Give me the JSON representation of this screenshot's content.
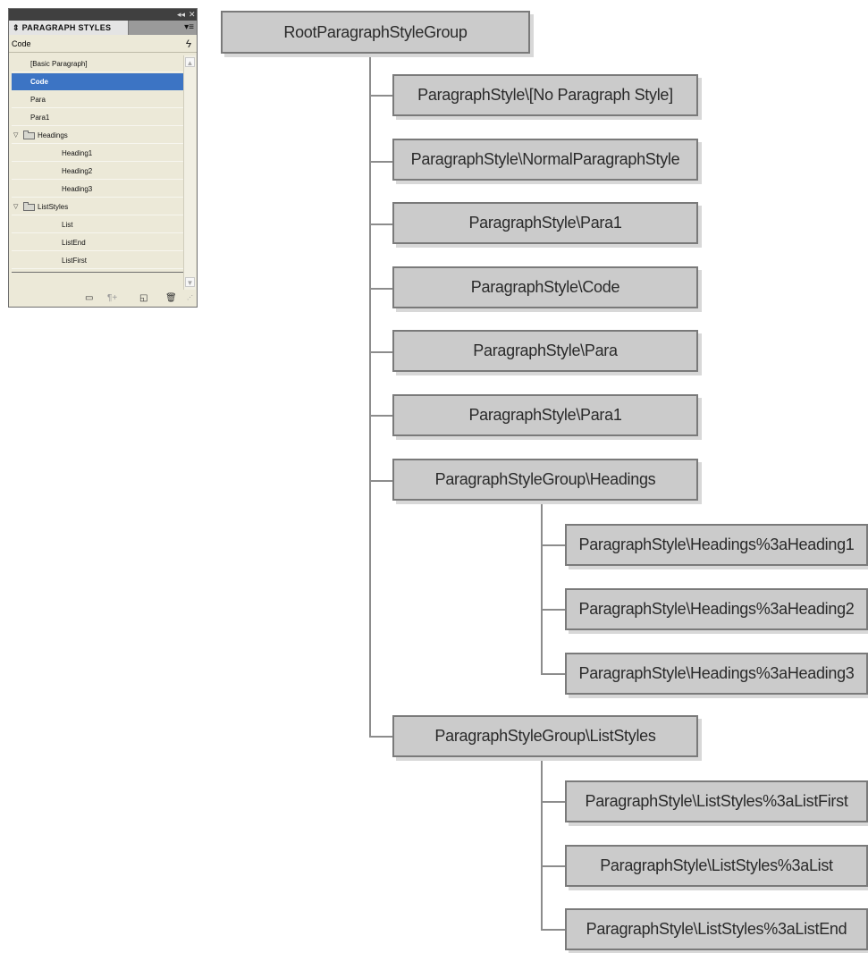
{
  "panel": {
    "title": "PARAGRAPH STYLES",
    "collapse_glyph": "◂◂",
    "close_glyph": "✕",
    "menu_glyph": "▾≡",
    "current_style": "Code",
    "quick_apply_icon": "lightning-bolt-icon",
    "items": [
      {
        "label": "[Basic Paragraph]",
        "level": 1,
        "selected": false
      },
      {
        "label": "Code",
        "level": 1,
        "selected": true
      },
      {
        "label": "Para",
        "level": 1,
        "selected": false
      },
      {
        "label": "Para1",
        "level": 1,
        "selected": false
      },
      {
        "label": "Headings",
        "level": 0,
        "folder": true,
        "expanded": true
      },
      {
        "label": "Heading1",
        "level": 2,
        "selected": false
      },
      {
        "label": "Heading2",
        "level": 2,
        "selected": false
      },
      {
        "label": "Heading3",
        "level": 2,
        "selected": false
      },
      {
        "label": "ListStyles",
        "level": 0,
        "folder": true,
        "expanded": true
      },
      {
        "label": "List",
        "level": 2,
        "selected": false
      },
      {
        "label": "ListEnd",
        "level": 2,
        "selected": false
      },
      {
        "label": "ListFirst",
        "level": 2,
        "selected": false
      }
    ],
    "bottom_icons": [
      "new-group-icon",
      "clear-overrides-icon",
      "new-style-icon",
      "delete-icon"
    ],
    "selection_color": "#3c74c4"
  },
  "tree": {
    "root": "RootParagraphStyleGroup",
    "children": [
      "ParagraphStyle\\[No Paragraph Style]",
      "ParagraphStyle\\NormalParagraphStyle",
      "ParagraphStyle\\Para1",
      "ParagraphStyle\\Code",
      "ParagraphStyle\\Para",
      "ParagraphStyle\\Para1",
      "ParagraphStyleGroup\\Headings",
      "ParagraphStyleGroup\\ListStyles"
    ],
    "headings_children": [
      "ParagraphStyle\\Headings%3aHeading1",
      "ParagraphStyle\\Headings%3aHeading2",
      "ParagraphStyle\\Headings%3aHeading3"
    ],
    "liststyles_children": [
      "ParagraphStyle\\ListStyles%3aListFirst",
      "ParagraphStyle\\ListStyles%3aList",
      "ParagraphStyle\\ListStyles%3aListEnd"
    ],
    "node_fill": "#cbcbcb",
    "node_border": "#7a7a7a"
  }
}
